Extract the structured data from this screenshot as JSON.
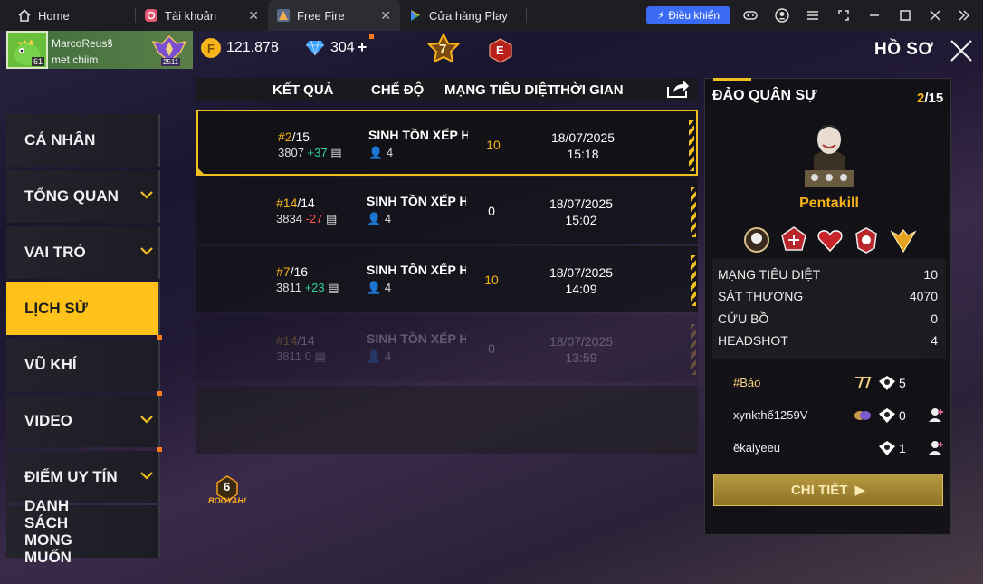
{
  "browser": {
    "tabs": [
      {
        "label": "Home"
      },
      {
        "label": "Tài khoản"
      },
      {
        "label": "Free Fire"
      },
      {
        "label": "Cửa hàng Play"
      }
    ],
    "control_button": "Điều khiển"
  },
  "player": {
    "name": "MarcoReusꝸ",
    "status": "met chiim",
    "level": "61",
    "rank_points": "2511"
  },
  "currency": {
    "gold": "121.878",
    "diamonds": "304",
    "diamond_add": "+"
  },
  "badges": {
    "rank_star": "7",
    "elite": "E"
  },
  "header": {
    "title": "HỒ SƠ"
  },
  "sidebar": {
    "items": [
      {
        "label": "CÁ NHÂN"
      },
      {
        "label": "TỔNG QUAN"
      },
      {
        "label": "VAI TRÒ"
      },
      {
        "label": "LỊCH SỬ"
      },
      {
        "label": "VŨ KHÍ"
      },
      {
        "label": "VIDEO"
      },
      {
        "label": "ĐIỂM UY TÍN"
      },
      {
        "label": "DANH SÁCH MONG MUỐN"
      }
    ]
  },
  "table": {
    "headers": [
      "KẾT QUẢ",
      "CHẾ ĐỘ",
      "MẠNG TIÊU DIỆT",
      "THỜI GIAN"
    ],
    "rows": [
      {
        "rank": "#2",
        "total": "/15",
        "points": "3807",
        "delta": "+37",
        "mode": "SINH TỒN XẾP HẠ",
        "players": "4",
        "kills": "10",
        "date": "18/07/2025",
        "time": "15:18"
      },
      {
        "rank": "#14",
        "total": "/14",
        "points": "3834",
        "delta": "-27",
        "mode": "SINH TỒN XẾP HẠ",
        "players": "4",
        "kills": "0",
        "date": "18/07/2025",
        "time": "15:02"
      },
      {
        "rank": "#7",
        "total": "/16",
        "points": "3811",
        "delta": "+23",
        "mode": "SINH TỒN XẾP HẠ",
        "players": "4",
        "kills": "10",
        "date": "18/07/2025",
        "time": "14:09"
      },
      {
        "rank": "#14",
        "total": "/14",
        "points": "3811",
        "delta": "0",
        "mode": "SINH TỒN XẾP HẠ",
        "players": "4",
        "kills": "0",
        "date": "18/07/2025",
        "time": "13:59"
      }
    ]
  },
  "booyah": {
    "count": "6",
    "label": "BOOYAH!"
  },
  "detail_panel": {
    "map": "ĐẢO QUÂN SỰ",
    "place": "2",
    "of": "/15",
    "title_award": "Pentakill",
    "stats": [
      {
        "label": "MẠNG TIÊU DIỆT",
        "value": "10"
      },
      {
        "label": "SÁT THƯƠNG",
        "value": "4070"
      },
      {
        "label": "CỨU BỒ",
        "value": "0"
      },
      {
        "label": "HEADSHOT",
        "value": "4"
      }
    ],
    "team": [
      {
        "name": "#Bảo",
        "kills": "5"
      },
      {
        "name": "xynkthế1259V",
        "kills": "0"
      },
      {
        "name": "ěkaiyeeu",
        "kills": "1"
      }
    ],
    "detail_button": "CHI TIẾT"
  },
  "colors": {
    "accent_yellow": "#f0c020",
    "gain_green": "#2ed49b",
    "loss_red": "#ff5a4a",
    "browser_blue": "#3b6af5"
  }
}
